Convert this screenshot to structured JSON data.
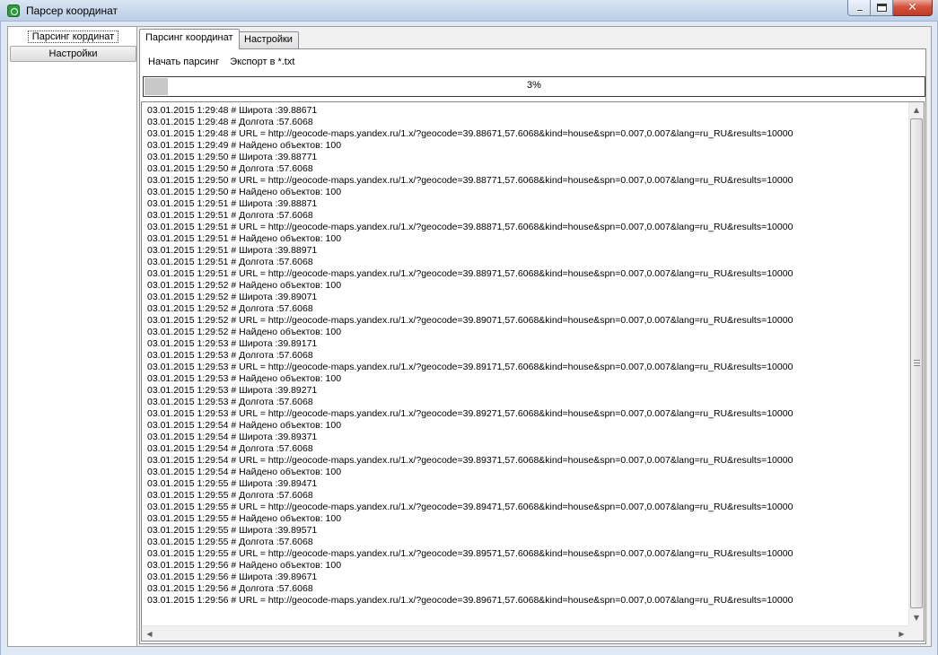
{
  "window": {
    "title": "Парсер координат"
  },
  "sidebar": {
    "items": [
      {
        "label": "Парсинг кординат"
      },
      {
        "label": "Настройки"
      }
    ]
  },
  "tabs": [
    {
      "label": "Парсинг координат"
    },
    {
      "label": "Настройки"
    }
  ],
  "toolbar": {
    "start_label": "Начать парсинг",
    "export_label": "Экспорт в *.txt"
  },
  "progress": {
    "text": "3%",
    "value": 0.03
  },
  "log": [
    "03.01.2015 1:29:48 # Широта :39.88671",
    "03.01.2015 1:29:48 # Долгота :57.6068",
    "03.01.2015 1:29:48 # URL = http://geocode-maps.yandex.ru/1.x/?geocode=39.88671,57.6068&kind=house&spn=0.007,0.007&lang=ru_RU&results=10000",
    "03.01.2015 1:29:49 # Найдено объектов: 100",
    "03.01.2015 1:29:50 # Широта :39.88771",
    "03.01.2015 1:29:50 # Долгота :57.6068",
    "03.01.2015 1:29:50 # URL = http://geocode-maps.yandex.ru/1.x/?geocode=39.88771,57.6068&kind=house&spn=0.007,0.007&lang=ru_RU&results=10000",
    "03.01.2015 1:29:50 # Найдено объектов: 100",
    "03.01.2015 1:29:51 # Широта :39.88871",
    "03.01.2015 1:29:51 # Долгота :57.6068",
    "03.01.2015 1:29:51 # URL = http://geocode-maps.yandex.ru/1.x/?geocode=39.88871,57.6068&kind=house&spn=0.007,0.007&lang=ru_RU&results=10000",
    "03.01.2015 1:29:51 # Найдено объектов: 100",
    "03.01.2015 1:29:51 # Широта :39.88971",
    "03.01.2015 1:29:51 # Долгота :57.6068",
    "03.01.2015 1:29:51 # URL = http://geocode-maps.yandex.ru/1.x/?geocode=39.88971,57.6068&kind=house&spn=0.007,0.007&lang=ru_RU&results=10000",
    "03.01.2015 1:29:52 # Найдено объектов: 100",
    "03.01.2015 1:29:52 # Широта :39.89071",
    "03.01.2015 1:29:52 # Долгота :57.6068",
    "03.01.2015 1:29:52 # URL = http://geocode-maps.yandex.ru/1.x/?geocode=39.89071,57.6068&kind=house&spn=0.007,0.007&lang=ru_RU&results=10000",
    "03.01.2015 1:29:52 # Найдено объектов: 100",
    "03.01.2015 1:29:53 # Широта :39.89171",
    "03.01.2015 1:29:53 # Долгота :57.6068",
    "03.01.2015 1:29:53 # URL = http://geocode-maps.yandex.ru/1.x/?geocode=39.89171,57.6068&kind=house&spn=0.007,0.007&lang=ru_RU&results=10000",
    "03.01.2015 1:29:53 # Найдено объектов: 100",
    "03.01.2015 1:29:53 # Широта :39.89271",
    "03.01.2015 1:29:53 # Долгота :57.6068",
    "03.01.2015 1:29:53 # URL = http://geocode-maps.yandex.ru/1.x/?geocode=39.89271,57.6068&kind=house&spn=0.007,0.007&lang=ru_RU&results=10000",
    "03.01.2015 1:29:54 # Найдено объектов: 100",
    "03.01.2015 1:29:54 # Широта :39.89371",
    "03.01.2015 1:29:54 # Долгота :57.6068",
    "03.01.2015 1:29:54 # URL = http://geocode-maps.yandex.ru/1.x/?geocode=39.89371,57.6068&kind=house&spn=0.007,0.007&lang=ru_RU&results=10000",
    "03.01.2015 1:29:54 # Найдено объектов: 100",
    "03.01.2015 1:29:55 # Широта :39.89471",
    "03.01.2015 1:29:55 # Долгота :57.6068",
    "03.01.2015 1:29:55 # URL = http://geocode-maps.yandex.ru/1.x/?geocode=39.89471,57.6068&kind=house&spn=0.007,0.007&lang=ru_RU&results=10000",
    "03.01.2015 1:29:55 # Найдено объектов: 100",
    "03.01.2015 1:29:55 # Широта :39.89571",
    "03.01.2015 1:29:55 # Долгота :57.6068",
    "03.01.2015 1:29:55 # URL = http://geocode-maps.yandex.ru/1.x/?geocode=39.89571,57.6068&kind=house&spn=0.007,0.007&lang=ru_RU&results=10000",
    "03.01.2015 1:29:56 # Найдено объектов: 100",
    "03.01.2015 1:29:56 # Широта :39.89671",
    "03.01.2015 1:29:56 # Долгота :57.6068",
    "03.01.2015 1:29:56 # URL = http://geocode-maps.yandex.ru/1.x/?geocode=39.89671,57.6068&kind=house&spn=0.007,0.007&lang=ru_RU&results=10000"
  ],
  "icons": {
    "app": "app-icon",
    "minimize": "minimize-icon",
    "maximize": "maximize-icon",
    "close": "close-icon",
    "scroll_up": "chevron-up-icon",
    "scroll_down": "chevron-down-icon",
    "scroll_left": "chevron-left-icon",
    "scroll_right": "chevron-right-icon"
  },
  "colors": {
    "title_bar": "#c9d9ec",
    "close_button": "#c23a22",
    "progress_fill": "#c8c8c8"
  }
}
